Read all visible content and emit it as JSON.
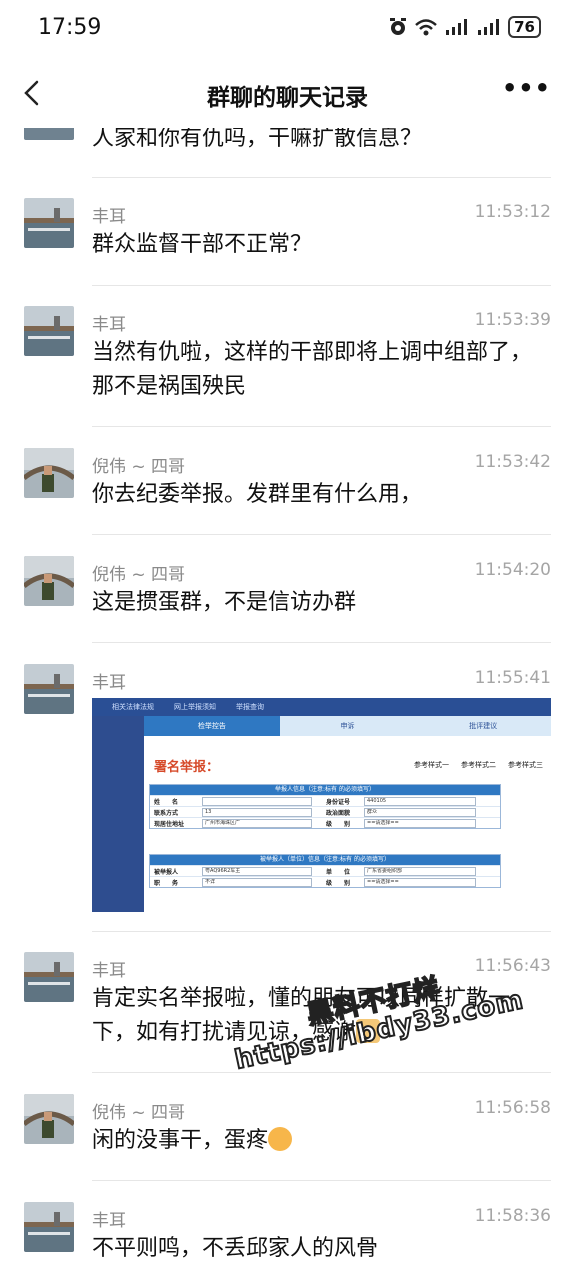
{
  "status_bar": {
    "time": "17:59",
    "icons": [
      "alarm-icon",
      "wifi-icon",
      "signal-icon",
      "signal-icon"
    ],
    "battery": "76"
  },
  "header": {
    "title": "群聊的聊天记录",
    "back_icon": "chevron-left-icon",
    "more_label": "•••"
  },
  "messages": [
    {
      "sender": "",
      "time": "",
      "text": "人家和你有仇吗，干嘛扩散信息？",
      "avatar": "harbor"
    },
    {
      "sender": "丰耳",
      "time": "11:53:12",
      "text": "群众监督干部不正常？",
      "avatar": "harbor"
    },
    {
      "sender": "丰耳",
      "time": "11:53:39",
      "text": "当然有仇啦，这样的干部即将上调中组部了，那不是祸国殃民",
      "avatar": "harbor"
    },
    {
      "sender": "倪伟 ~ 四哥",
      "time": "11:53:42",
      "text": "你去纪委举报。发群里有什么用，",
      "avatar": "bridge"
    },
    {
      "sender": "倪伟 ~ 四哥",
      "time": "11:54:20",
      "text": "这是掼蛋群，不是信访办群",
      "avatar": "bridge"
    },
    {
      "sender": "丰耳",
      "time": "11:55:41",
      "text": "",
      "avatar": "harbor"
    },
    {
      "sender": "丰耳",
      "time": "11:56:43",
      "text": "肯定实名举报啦，懂的朋友可以同样扩散一下，如有打扰请见谅，感谢",
      "avatar": "harbor"
    },
    {
      "sender": "倪伟 ~ 四哥",
      "time": "11:56:58",
      "text": "闲的没事干，蛋疼",
      "avatar": "bridge"
    },
    {
      "sender": "丰耳",
      "time": "11:58:36",
      "text": "不平则鸣，不丢邱家人的风骨",
      "avatar": "harbor"
    }
  ],
  "form_image": {
    "top_nav": [
      "相关法律法规",
      "网上举报须知",
      "举报查询"
    ],
    "tabs": [
      "检举控告",
      "申诉",
      "批评建议"
    ],
    "title": "署名举报：",
    "samples": [
      "参考样式一",
      "参考样式二",
      "参考样式三"
    ],
    "reporter_header": "举报人信息（注意:标有   的必须填写）",
    "reporter_rows": [
      {
        "l1": "姓　　名",
        "v1": "",
        "l2": "身份证号",
        "v2": "440105"
      },
      {
        "l1": "联系方式",
        "v1": "13",
        "l2": "政治面貌",
        "v2": "群众"
      },
      {
        "l1": "现居住地址",
        "v1": "广州市海珠区广",
        "l2": "级　　别",
        "v2": "==请选择=="
      }
    ],
    "accused_header": "被举报人（单位）信息（注意:标有   的必须填写）",
    "accused_rows": [
      {
        "l1": "被举报人",
        "v1": "粤AQ96R2车主",
        "l2": "单　　位",
        "v2": "广东省委组织部"
      },
      {
        "l1": "职　　务",
        "v1": "不详",
        "l2": "级　　别",
        "v2": "==请选择=="
      }
    ]
  },
  "watermark": {
    "line1": "黑料不打烊",
    "line2": "https://ibdy33.com"
  }
}
